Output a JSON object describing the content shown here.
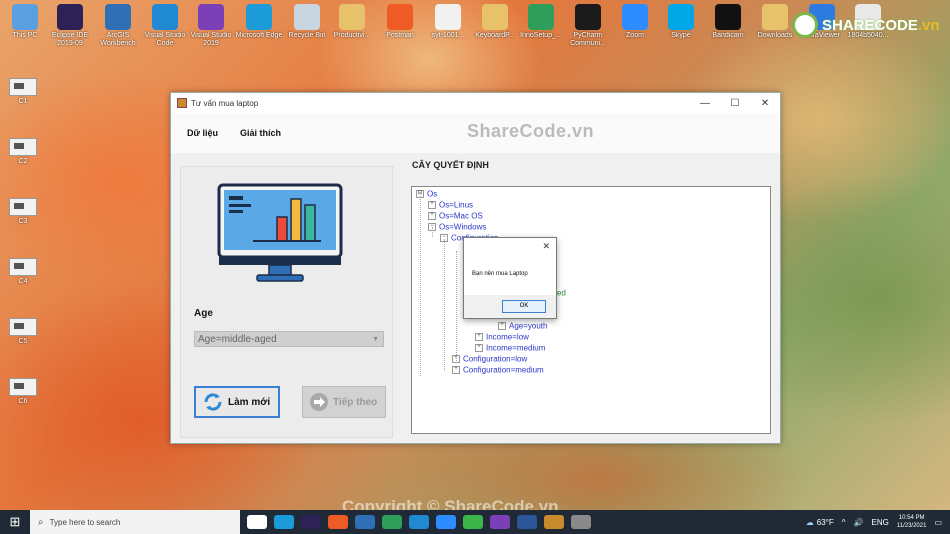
{
  "desktop": {
    "top_icons": [
      {
        "label": "This PC",
        "icon": "computer-icon",
        "color": "#5aa0e0"
      },
      {
        "label": "Eclipse IDE 2019-09",
        "icon": "eclipse-icon",
        "color": "#2c2255"
      },
      {
        "label": "ArcGIS Workbench",
        "icon": "arcgis-icon",
        "color": "#2f6fb5"
      },
      {
        "label": "Visual Studio Code",
        "icon": "vscode-icon",
        "color": "#1f8ad2"
      },
      {
        "label": "Visual Studio 2019",
        "icon": "visual-studio-icon",
        "color": "#7b3fb8"
      },
      {
        "label": "Microsoft Edge",
        "icon": "edge-icon",
        "color": "#1b9bd8"
      },
      {
        "label": "Recycle Bin",
        "icon": "recycle-bin-icon",
        "color": "#c9d6df"
      },
      {
        "label": "Productivi...",
        "icon": "folder-icon",
        "color": "#e8c26a"
      },
      {
        "label": "Postman",
        "icon": "postman-icon",
        "color": "#ef5b25"
      },
      {
        "label": "syt-1001...",
        "icon": "file-icon",
        "color": "#f1f1f1"
      },
      {
        "label": "KeyboardP...",
        "icon": "folder-icon",
        "color": "#e8c26a"
      },
      {
        "label": "InnoSetup_...",
        "icon": "inno-icon",
        "color": "#2e9e5a"
      },
      {
        "label": "PyCharm Communi...",
        "icon": "pycharm-icon",
        "color": "#1a1a1a"
      },
      {
        "label": "Zoom",
        "icon": "zoom-icon",
        "color": "#2d8cff"
      },
      {
        "label": "Skype",
        "icon": "skype-icon",
        "color": "#00a7e7"
      },
      {
        "label": "Bandicam",
        "icon": "bandicam-icon",
        "color": "#111111"
      },
      {
        "label": "Downloads",
        "icon": "folder-icon",
        "color": "#e8c26a"
      },
      {
        "label": "UltraViewer",
        "icon": "ultraviewer-icon",
        "color": "#2d7be0"
      },
      {
        "label": "1804b5040...",
        "icon": "file-icon",
        "color": "#e9e9e9"
      }
    ],
    "left_icons": [
      "C1",
      "C2",
      "C3",
      "C4",
      "C5",
      "C6"
    ],
    "watermark": "Copyright © ShareCode.vn",
    "brand": {
      "main": "SHARECODE",
      "suffix": ".vn"
    }
  },
  "window": {
    "title": "Tư vấn mua laptop",
    "controls": {
      "minimize": "—",
      "maximize": "☐",
      "close": "✕"
    },
    "menu": [
      "Dữ liệu",
      "Giải thích"
    ],
    "watermark": "ShareCode.vn",
    "left": {
      "field_label": "Age",
      "combo_value": "Age=middle-aged",
      "btn_refresh": "Làm mới",
      "btn_next": "Tiếp theo"
    },
    "tree": {
      "title": "CÂY QUYẾT ĐỊNH",
      "nodes": [
        {
          "text": "Os",
          "sign": "⊟"
        },
        {
          "text": "Os=Linus",
          "sign": "+"
        },
        {
          "text": "Os=Mac OS",
          "sign": "+"
        },
        {
          "text": "Os=Windows",
          "sign": "−"
        },
        {
          "text": "Configuration",
          "sign": "−"
        },
        {
          "text": "aged",
          "sign": ""
        },
        {
          "text": "Age=youth",
          "sign": "+"
        },
        {
          "text": "Income=low",
          "sign": "+"
        },
        {
          "text": "Income=medium",
          "sign": "+"
        },
        {
          "text": "Configuration=low",
          "sign": "+"
        },
        {
          "text": "Configuration=medium",
          "sign": "+"
        }
      ]
    }
  },
  "dialog": {
    "message": "Bạn nên mua Laptop",
    "ok": "OK",
    "close": "✕"
  },
  "taskbar": {
    "search_placeholder": "Type here to search",
    "weather": "63°F",
    "language": "ENG",
    "time": "10:54 PM",
    "date": "11/23/2021",
    "app_colors": [
      "#ffffff",
      "#1b9bd8",
      "#2c2255",
      "#ef5b25",
      "#2f6fb5",
      "#2e9e5a",
      "#1f8ad2",
      "#2d8cff",
      "#3bb54a",
      "#7b3fb8",
      "#2b579a",
      "#c88a2a",
      "#8a8a8a"
    ]
  }
}
